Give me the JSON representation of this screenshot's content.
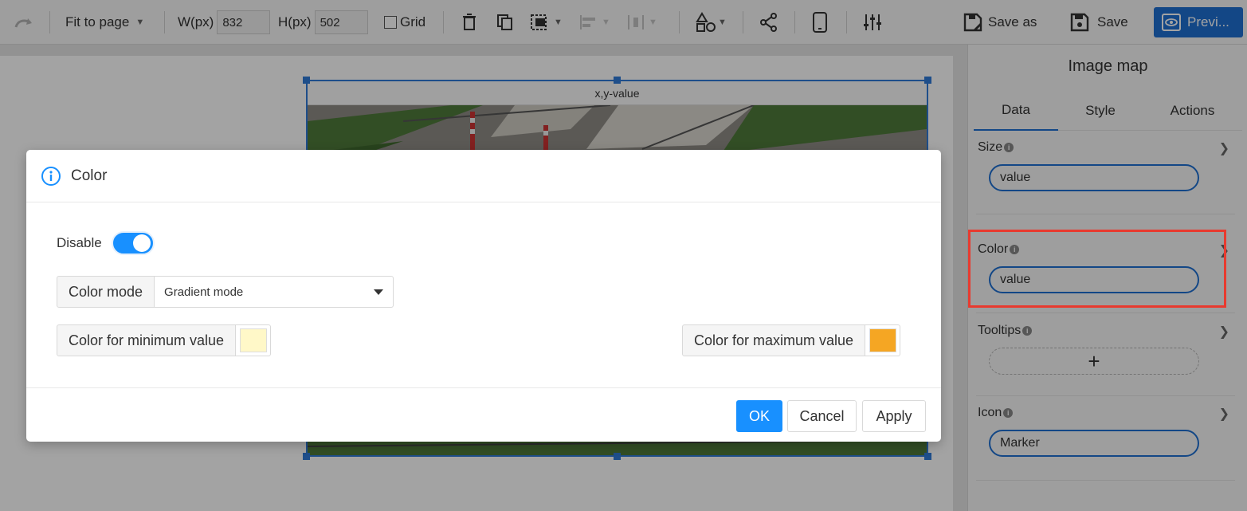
{
  "toolbar": {
    "zoom_label": "Fit to page",
    "width_label": "W(px)",
    "width_value": "832",
    "height_label": "H(px)",
    "height_value": "502",
    "grid_label": "Grid",
    "save_as_label": "Save as",
    "save_label": "Save",
    "preview_label": "Previ..."
  },
  "canvas": {
    "widget_title": "x,y-value"
  },
  "dialog": {
    "title": "Color",
    "disable_label": "Disable",
    "color_mode_label": "Color mode",
    "color_mode_value": "Gradient mode",
    "min_color_label": "Color for minimum value",
    "min_color": "#fff8c8",
    "max_color_label": "Color for maximum value",
    "max_color": "#f5a623",
    "ok_label": "OK",
    "cancel_label": "Cancel",
    "apply_label": "Apply"
  },
  "panel": {
    "title": "Image map",
    "tabs": [
      "Data",
      "Style",
      "Actions"
    ],
    "sections": {
      "size": {
        "label": "Size",
        "value": "value"
      },
      "color": {
        "label": "Color",
        "value": "value"
      },
      "tooltips": {
        "label": "Tooltips",
        "add": "+"
      },
      "icon": {
        "label": "Icon",
        "value": "Marker"
      }
    }
  },
  "colors": {
    "accent": "#1e6fd2",
    "primary_button": "#1890ff",
    "highlight": "#e83a2f"
  }
}
